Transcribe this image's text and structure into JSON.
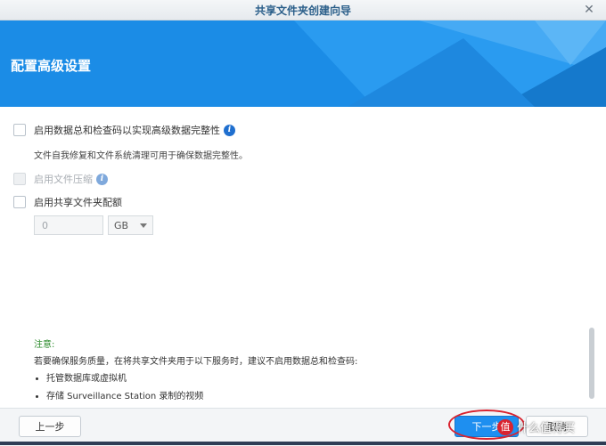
{
  "window": {
    "title": "共享文件夹创建向导",
    "close_glyph": "✕"
  },
  "banner": {
    "heading": "配置高级设置"
  },
  "options": {
    "checksum": {
      "label": "启用数据总和检查码以实现高级数据完整性",
      "description": "文件自我修复和文件系统清理可用于确保数据完整性。"
    },
    "compression": {
      "label": "启用文件压缩"
    },
    "quota": {
      "label": "启用共享文件夹配额",
      "value": "0",
      "unit": "GB"
    }
  },
  "note": {
    "title": "注意:",
    "text": "若要确保服务质量，在将共享文件夹用于以下服务时，建议不启用数据总和检查码:",
    "items": [
      "托管数据库或虚拟机",
      "存储 Surveillance Station 录制的视频"
    ]
  },
  "footer": {
    "prev_label": "上一步",
    "next_label": "下一步",
    "cancel_label": "取消"
  },
  "watermark": {
    "badge": "值",
    "text": "什么值得买"
  },
  "colors": {
    "banner": "#1b8ce6",
    "primary_button": "#1e8ff0",
    "note_title": "#2a8a2a",
    "annotation": "#d9232f"
  }
}
